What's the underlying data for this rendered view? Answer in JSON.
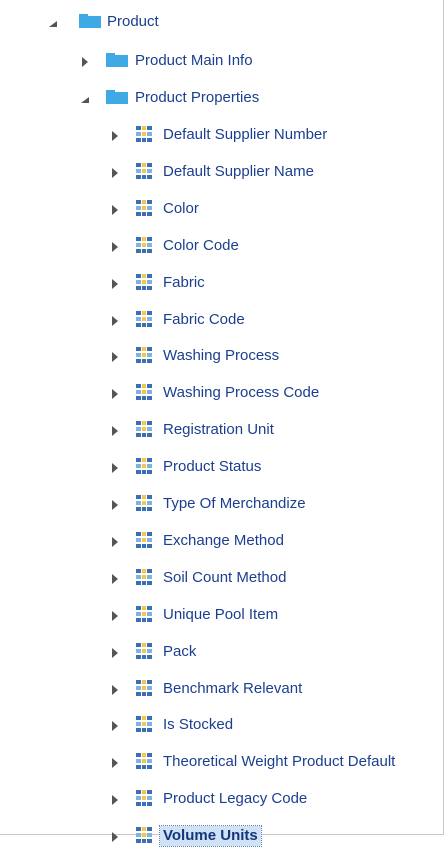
{
  "tree": {
    "root": {
      "label": "Product",
      "icon": "folder-icon",
      "expanded": true
    },
    "folders": [
      {
        "label": "Product Main Info",
        "icon": "folder-icon",
        "expanded": false
      },
      {
        "label": "Product Properties",
        "icon": "folder-icon",
        "expanded": true
      }
    ],
    "properties": [
      {
        "label": "Default Supplier Number",
        "icon": "attribute-icon"
      },
      {
        "label": "Default Supplier Name",
        "icon": "attribute-icon"
      },
      {
        "label": "Color",
        "icon": "attribute-icon"
      },
      {
        "label": "Color Code",
        "icon": "attribute-icon"
      },
      {
        "label": "Fabric",
        "icon": "attribute-icon"
      },
      {
        "label": "Fabric Code",
        "icon": "attribute-icon"
      },
      {
        "label": "Washing Process",
        "icon": "attribute-icon"
      },
      {
        "label": "Washing Process Code",
        "icon": "attribute-icon"
      },
      {
        "label": "Registration Unit",
        "icon": "attribute-icon"
      },
      {
        "label": "Product Status",
        "icon": "attribute-icon"
      },
      {
        "label": "Type Of Merchandize",
        "icon": "attribute-icon"
      },
      {
        "label": "Exchange Method",
        "icon": "attribute-icon"
      },
      {
        "label": "Soil Count Method",
        "icon": "attribute-icon"
      },
      {
        "label": "Unique Pool Item",
        "icon": "attribute-icon"
      },
      {
        "label": "Pack",
        "icon": "attribute-icon"
      },
      {
        "label": "Benchmark Relevant",
        "icon": "attribute-icon"
      },
      {
        "label": "Is Stocked",
        "icon": "attribute-icon"
      },
      {
        "label": "Theoretical Weight Product Default",
        "icon": "attribute-icon"
      },
      {
        "label": "Product Legacy Code",
        "icon": "attribute-icon"
      },
      {
        "label": "Volume Units",
        "icon": "attribute-icon",
        "selected": true
      }
    ],
    "colors": {
      "label": "#1b3f8e",
      "folder": "#3fa9e6",
      "selection": "#cfe2f6",
      "toggle": "#555555"
    }
  }
}
